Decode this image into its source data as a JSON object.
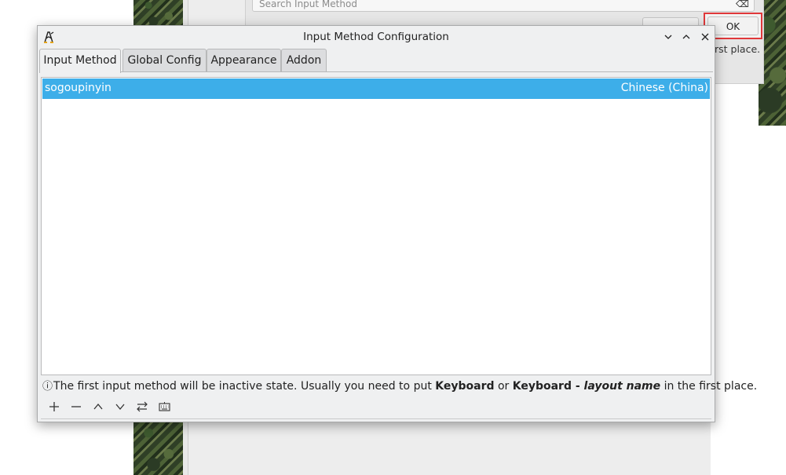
{
  "background_dialog": {
    "search_placeholder": "Search Input Method",
    "ok_label": "OK",
    "hint_fragment": "rst place."
  },
  "window": {
    "title": "Input Method Configuration",
    "app_icon": "fcitx-penguin-icon",
    "controls": [
      "minimize-icon",
      "maximize-icon",
      "close-icon"
    ]
  },
  "tabs": [
    {
      "label": "Input Method",
      "active": true
    },
    {
      "label": "Global Config",
      "active": false
    },
    {
      "label": "Appearance",
      "active": false
    },
    {
      "label": "Addon",
      "active": false
    }
  ],
  "input_methods": [
    {
      "name": "sogoupinyin",
      "language": "Chinese (China)",
      "selected": true
    }
  ],
  "info": {
    "prefix": "The first input method will be inactive state. Usually you need to put ",
    "keyword1": "Keyboard",
    "or": " or ",
    "keyword2": "Keyboard - ",
    "keyword2_italic": "layout name",
    "suffix": " in the first place."
  },
  "toolbar": [
    "add-icon",
    "remove-icon",
    "move-up-icon",
    "move-down-icon",
    "configure-icon",
    "keyboard-icon"
  ],
  "colors": {
    "selection": "#3daee9",
    "highlight_border": "#e0383a",
    "window_bg": "#eff0f1"
  }
}
